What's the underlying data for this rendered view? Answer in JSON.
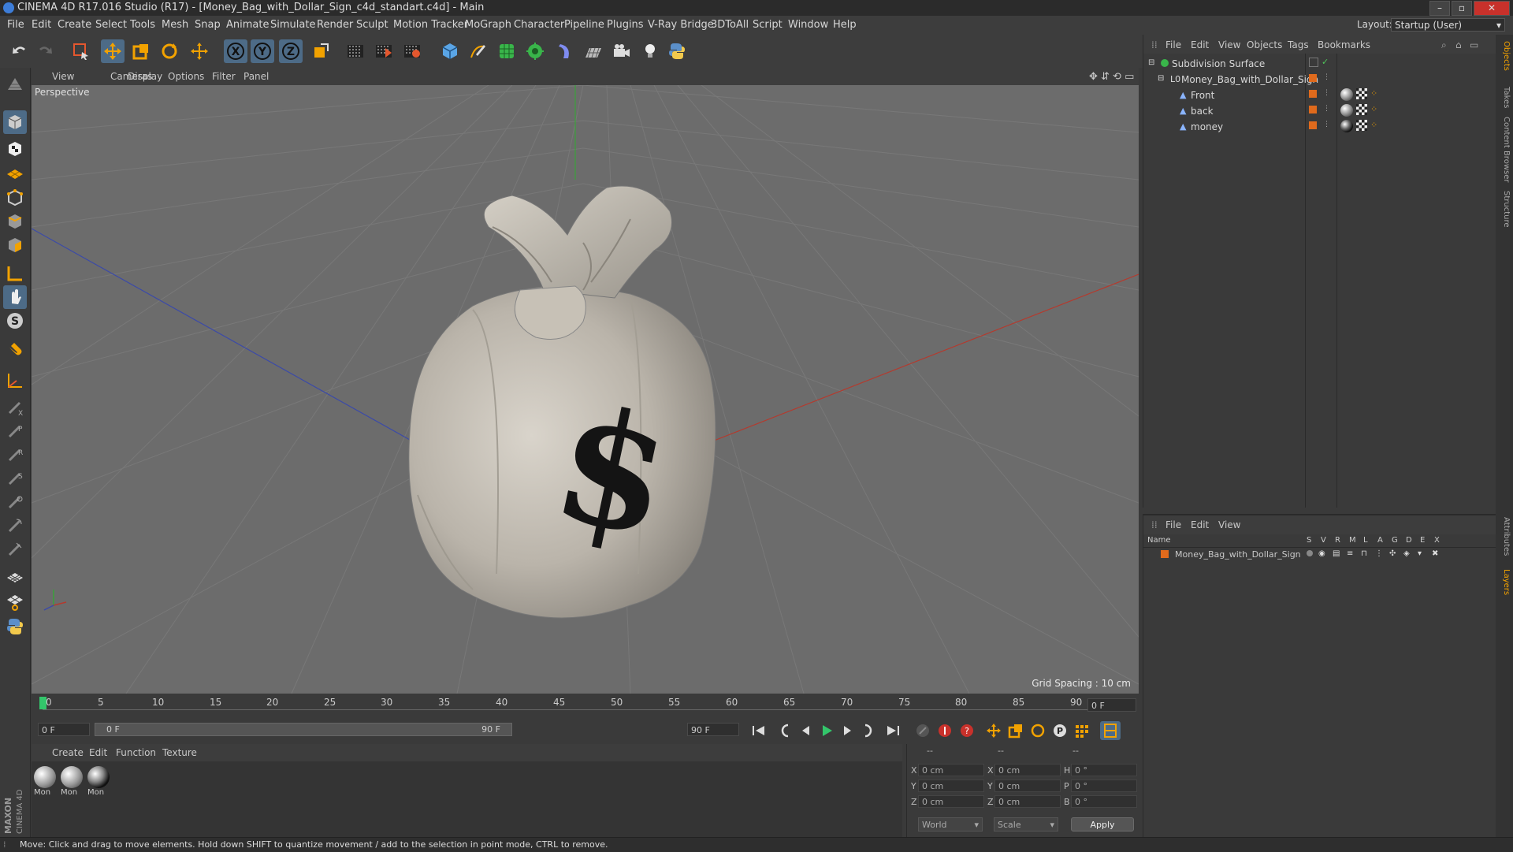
{
  "window": {
    "title": "CINEMA 4D R17.016 Studio (R17) - [Money_Bag_with_Dollar_Sign_c4d_standart.c4d] - Main"
  },
  "menubar": {
    "items": [
      "File",
      "Edit",
      "Create",
      "Select",
      "Tools",
      "Mesh",
      "Snap",
      "Animate",
      "Simulate",
      "Render",
      "Sculpt",
      "Motion Tracker",
      "MoGraph",
      "Character",
      "Pipeline",
      "Plugins",
      "V-Ray Bridge",
      "3DToAll",
      "Script",
      "Window",
      "Help"
    ],
    "layout_label": "Layout:",
    "layout_value": "Startup (User)"
  },
  "viewport": {
    "menu": [
      "View",
      "Cameras",
      "Display",
      "Options",
      "Filter",
      "Panel"
    ],
    "label": "Perspective",
    "grid_spacing": "Grid Spacing : 10 cm",
    "object_text": "$"
  },
  "timeline": {
    "ticks": [
      "0",
      "5",
      "10",
      "15",
      "20",
      "25",
      "30",
      "35",
      "40",
      "45",
      "50",
      "55",
      "60",
      "65",
      "70",
      "75",
      "80",
      "85",
      "90"
    ],
    "current_frame": "0 F",
    "start_field": "0 F",
    "range_start": "0 F",
    "range_end": "90 F",
    "end_field": "90 F"
  },
  "materials": {
    "menu": [
      "Create",
      "Edit",
      "Function",
      "Texture"
    ],
    "items": [
      "Mon",
      "Mon",
      "Mon"
    ]
  },
  "coords": {
    "header": [
      "--",
      "--",
      "--"
    ],
    "rows": [
      {
        "a": "X",
        "av": "0 cm",
        "b": "X",
        "bv": "0 cm",
        "c": "H",
        "cv": "0 °"
      },
      {
        "a": "Y",
        "av": "0 cm",
        "b": "Y",
        "bv": "0 cm",
        "c": "P",
        "cv": "0 °"
      },
      {
        "a": "Z",
        "av": "0 cm",
        "b": "Z",
        "bv": "0 cm",
        "c": "B",
        "cv": "0 °"
      }
    ],
    "mode": "World",
    "scale": "Scale",
    "apply": "Apply"
  },
  "objects": {
    "menu": [
      "File",
      "Edit",
      "View",
      "Objects",
      "Tags",
      "Bookmarks"
    ],
    "rows": [
      "Subdivision Surface",
      "Money_Bag_with_Dollar_Sign",
      "Front",
      "back",
      "money"
    ]
  },
  "layers": {
    "menu": [
      "File",
      "Edit",
      "View"
    ],
    "col_name": "Name",
    "cols": [
      "S",
      "V",
      "R",
      "M",
      "L",
      "A",
      "G",
      "D",
      "E",
      "X"
    ],
    "rows": [
      "Money_Bag_with_Dollar_Sign"
    ]
  },
  "side_tabs": [
    "Objects",
    "Takes",
    "Content Browser",
    "Structure",
    "Attributes",
    "Layers"
  ],
  "brand": {
    "line1": "MAXON",
    "line2": "CINEMA 4D"
  },
  "status": "Move: Click and drag to move elements. Hold down SHIFT to quantize movement / add to the selection in point mode, CTRL to remove."
}
